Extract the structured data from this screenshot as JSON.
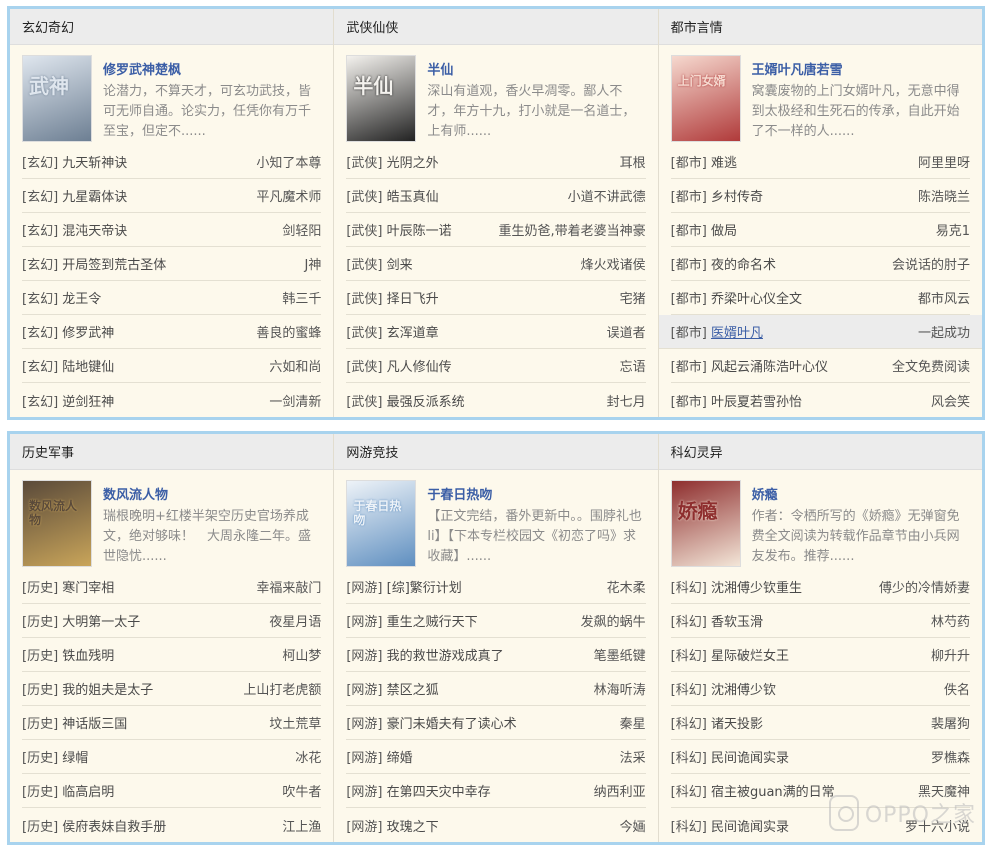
{
  "sections": [
    {
      "title": "玄幻奇幻",
      "featured": {
        "title": "修罗武神楚枫",
        "desc": "论潜力，不算天才，可玄功武技，皆可无师自通。论实力，任凭你有万千至宝，但定不......",
        "cover_text": "武神",
        "cover_colors": [
          "#dfe6ee",
          "#6d7f93"
        ]
      },
      "items": [
        {
          "cat": "[玄幻]",
          "name": "九天斩神诀",
          "author": "小知了本尊"
        },
        {
          "cat": "[玄幻]",
          "name": "九星霸体诀",
          "author": "平凡魔术师"
        },
        {
          "cat": "[玄幻]",
          "name": "混沌天帝诀",
          "author": "剑轻阳"
        },
        {
          "cat": "[玄幻]",
          "name": "开局签到荒古圣体",
          "author": "J神"
        },
        {
          "cat": "[玄幻]",
          "name": "龙王令",
          "author": "韩三千"
        },
        {
          "cat": "[玄幻]",
          "name": "修罗武神",
          "author": "善良的蜜蜂"
        },
        {
          "cat": "[玄幻]",
          "name": "陆地键仙",
          "author": "六如和尚"
        },
        {
          "cat": "[玄幻]",
          "name": "逆剑狂神",
          "author": "一剑清新"
        }
      ]
    },
    {
      "title": "武侠仙侠",
      "featured": {
        "title": "半仙",
        "desc": "深山有道观，香火早凋零。鄙人不才，年方十九，打小就是一名道士，上有师......",
        "cover_text": "半仙",
        "cover_colors": [
          "#f4f2ee",
          "#222222"
        ]
      },
      "items": [
        {
          "cat": "[武侠]",
          "name": "光阴之外",
          "author": "耳根"
        },
        {
          "cat": "[武侠]",
          "name": "皓玉真仙",
          "author": "小道不讲武德"
        },
        {
          "cat": "[武侠]",
          "name": "叶辰陈一诺",
          "author": "重生奶爸,带着老婆当神豪"
        },
        {
          "cat": "[武侠]",
          "name": "剑来",
          "author": "烽火戏诸侯"
        },
        {
          "cat": "[武侠]",
          "name": "择日飞升",
          "author": "宅猪"
        },
        {
          "cat": "[武侠]",
          "name": "玄浑道章",
          "author": "误道者"
        },
        {
          "cat": "[武侠]",
          "name": "凡人修仙传",
          "author": "忘语"
        },
        {
          "cat": "[武侠]",
          "name": "最强反派系统",
          "author": "封七月"
        }
      ]
    },
    {
      "title": "都市言情",
      "featured": {
        "title": "王婿叶凡唐若雪",
        "desc": "窝囊废物的上门女婿叶凡，无意中得到太极经和生死石的传承，自此开始了不一样的人......",
        "cover_text": "上门女婿",
        "cover_colors": [
          "#f6d9cf",
          "#b03a3a"
        ]
      },
      "items": [
        {
          "cat": "[都市]",
          "name": "难逃",
          "author": "阿里里呀"
        },
        {
          "cat": "[都市]",
          "name": "乡村传奇",
          "author": "陈浩晓兰"
        },
        {
          "cat": "[都市]",
          "name": "做局",
          "author": "易克1"
        },
        {
          "cat": "[都市]",
          "name": "夜的命名术",
          "author": "会说话的肘子"
        },
        {
          "cat": "[都市]",
          "name": "乔梁叶心仪全文",
          "author": "都市风云"
        },
        {
          "cat": "[都市]",
          "name": "医婿叶凡",
          "author": "一起成功"
        },
        {
          "cat": "[都市]",
          "name": "风起云涌陈浩叶心仪",
          "author": "全文免费阅读"
        },
        {
          "cat": "[都市]",
          "name": "叶辰夏若雪孙怡",
          "author": "风会笑"
        }
      ]
    },
    {
      "title": "历史军事",
      "featured": {
        "title": "数风流人物",
        "desc": "瑞根晚明+红楼半架空历史官场养成文，绝对够味！　大周永隆二年。盛世隐忧......",
        "cover_text": "数风流人物",
        "cover_colors": [
          "#5a4a3a",
          "#c9a55a"
        ]
      },
      "items": [
        {
          "cat": "[历史]",
          "name": "寒门宰相",
          "author": "幸福来敲门"
        },
        {
          "cat": "[历史]",
          "name": "大明第一太子",
          "author": "夜星月语"
        },
        {
          "cat": "[历史]",
          "name": "铁血残明",
          "author": "柯山梦"
        },
        {
          "cat": "[历史]",
          "name": "我的姐夫是太子",
          "author": "上山打老虎额"
        },
        {
          "cat": "[历史]",
          "name": "神话版三国",
          "author": "坟土荒草"
        },
        {
          "cat": "[历史]",
          "name": "绿帽",
          "author": "冰花"
        },
        {
          "cat": "[历史]",
          "name": "临高启明",
          "author": "吹牛者"
        },
        {
          "cat": "[历史]",
          "name": "侯府表妹自救手册",
          "author": "江上渔"
        }
      ]
    },
    {
      "title": "网游竞技",
      "featured": {
        "title": "于春日热吻",
        "desc": "【正文完结，番外更新中。。围脖礼也li】【下本专栏校园文《初恋了吗》求收藏】......",
        "cover_text": "于春日热吻",
        "cover_colors": [
          "#eef3f8",
          "#5f8fc0"
        ]
      },
      "items": [
        {
          "cat": "[网游]",
          "name": "[综]繁衍计划",
          "author": "花木柔"
        },
        {
          "cat": "[网游]",
          "name": "重生之贼行天下",
          "author": "发飙的蜗牛"
        },
        {
          "cat": "[网游]",
          "name": "我的救世游戏成真了",
          "author": "笔墨纸键"
        },
        {
          "cat": "[网游]",
          "name": "禁区之狐",
          "author": "林海听涛"
        },
        {
          "cat": "[网游]",
          "name": "豪门未婚夫有了读心术",
          "author": "秦星"
        },
        {
          "cat": "[网游]",
          "name": "缔婚",
          "author": "法采"
        },
        {
          "cat": "[网游]",
          "name": "在第四天灾中幸存",
          "author": "纳西利亚"
        },
        {
          "cat": "[网游]",
          "name": "玫瑰之下",
          "author": "今婳"
        }
      ]
    },
    {
      "title": "科幻灵异",
      "featured": {
        "title": "娇瘾",
        "desc": "作者：令栖所写的《娇瘾》无弹窗免费全文阅读为转载作品章节由小兵网友发布。推荐......",
        "cover_text": "娇瘾",
        "cover_colors": [
          "#8e2e2e",
          "#f3e6d8"
        ]
      },
      "items": [
        {
          "cat": "[科幻]",
          "name": "沈湘傅少钦重生",
          "author": "傅少的冷情娇妻"
        },
        {
          "cat": "[科幻]",
          "name": "香软玉滑",
          "author": "林芍药"
        },
        {
          "cat": "[科幻]",
          "name": "星际破烂女王",
          "author": "柳升升"
        },
        {
          "cat": "[科幻]",
          "name": "沈湘傅少钦",
          "author": "佚名"
        },
        {
          "cat": "[科幻]",
          "name": "诸天投影",
          "author": "裴屠狗"
        },
        {
          "cat": "[科幻]",
          "name": "民间诡闻实录",
          "author": "罗樵森"
        },
        {
          "cat": "[科幻]",
          "name": "宿主被guan满的日常",
          "author": "黑天魔神"
        },
        {
          "cat": "[科幻]",
          "name": "民间诡闻实录",
          "author": "罗十六小说"
        }
      ]
    }
  ],
  "highlighted": {
    "section": 2,
    "item": 5
  },
  "watermark": {
    "text": "OPPO之家",
    "icon": "oppo-logo-icon"
  },
  "colors": {
    "border": "#a8d3ee",
    "panel": "#fdf9ec",
    "header": "#ececec",
    "title": "#3b5ea6"
  }
}
